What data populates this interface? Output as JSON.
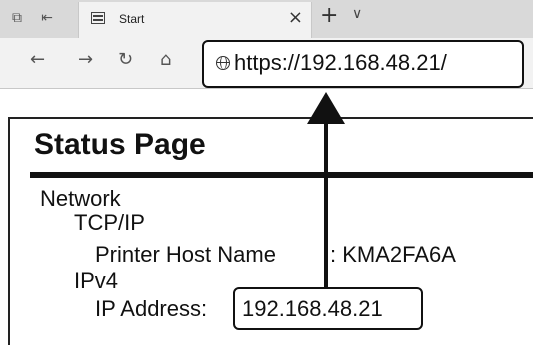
{
  "tab": {
    "title": "Start"
  },
  "address_bar": {
    "url": "https://192.168.48.21/"
  },
  "page": {
    "title": "Status Page",
    "tree": {
      "network": "Network",
      "tcpip": "TCP/IP",
      "host_label": "Printer Host Name",
      "host_value": ": KMA2FA6A",
      "ipv4": "IPv4",
      "ip_label": "IP Address: ",
      "ip_value": "192.168.48.21"
    }
  }
}
